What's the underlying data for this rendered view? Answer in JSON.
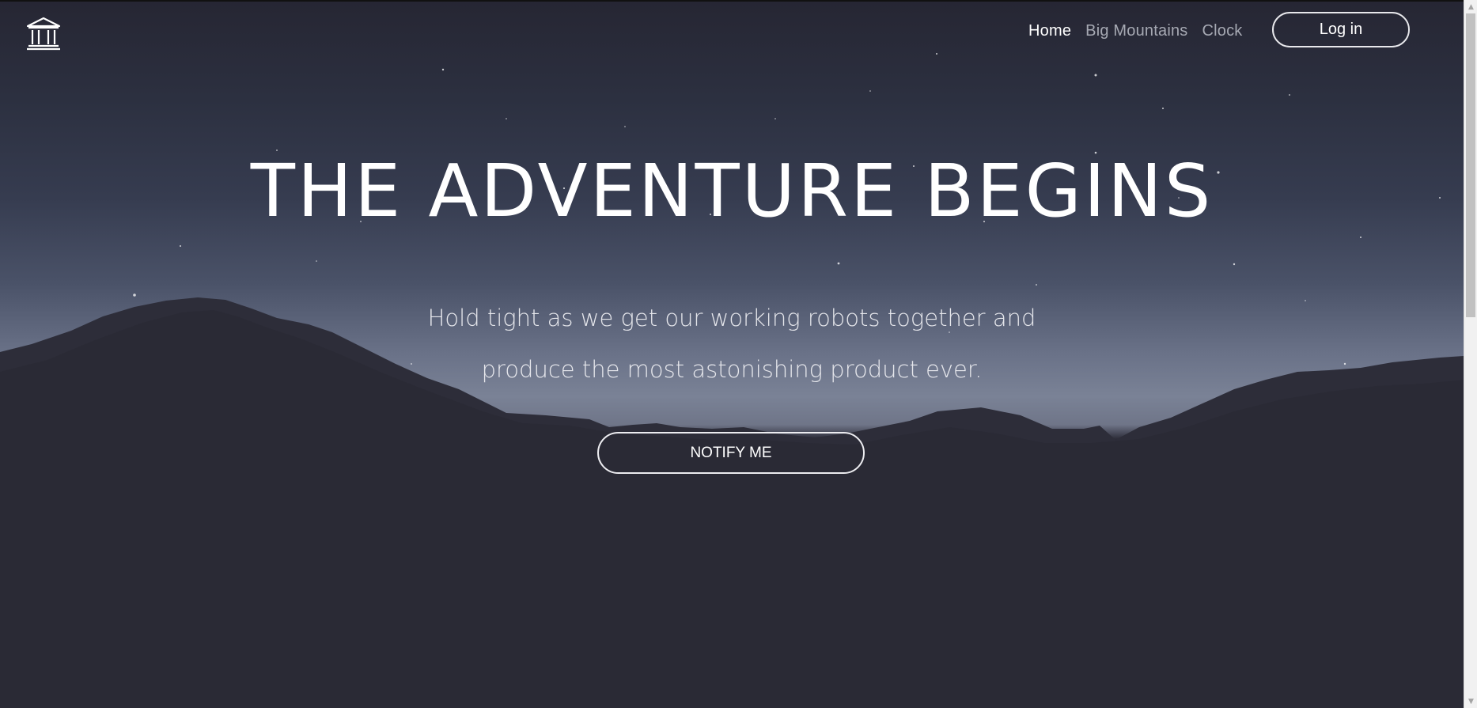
{
  "nav": {
    "logo_icon": "bank-building-icon",
    "links": [
      {
        "label": "Home",
        "active": true
      },
      {
        "label": "Big Mountains",
        "active": false
      },
      {
        "label": "Clock",
        "active": false
      }
    ],
    "login_label": "Log in"
  },
  "hero": {
    "headline": "THE ADVENTURE BEGINS",
    "subtitle_line1": "Hold tight as we get our working robots together and",
    "subtitle_line2": "produce the most astonishing product ever.",
    "cta_label": "NOTIFY ME"
  },
  "scrollbar": {
    "up_icon": "scroll-up-arrow-icon",
    "down_icon": "scroll-down-arrow-icon"
  }
}
